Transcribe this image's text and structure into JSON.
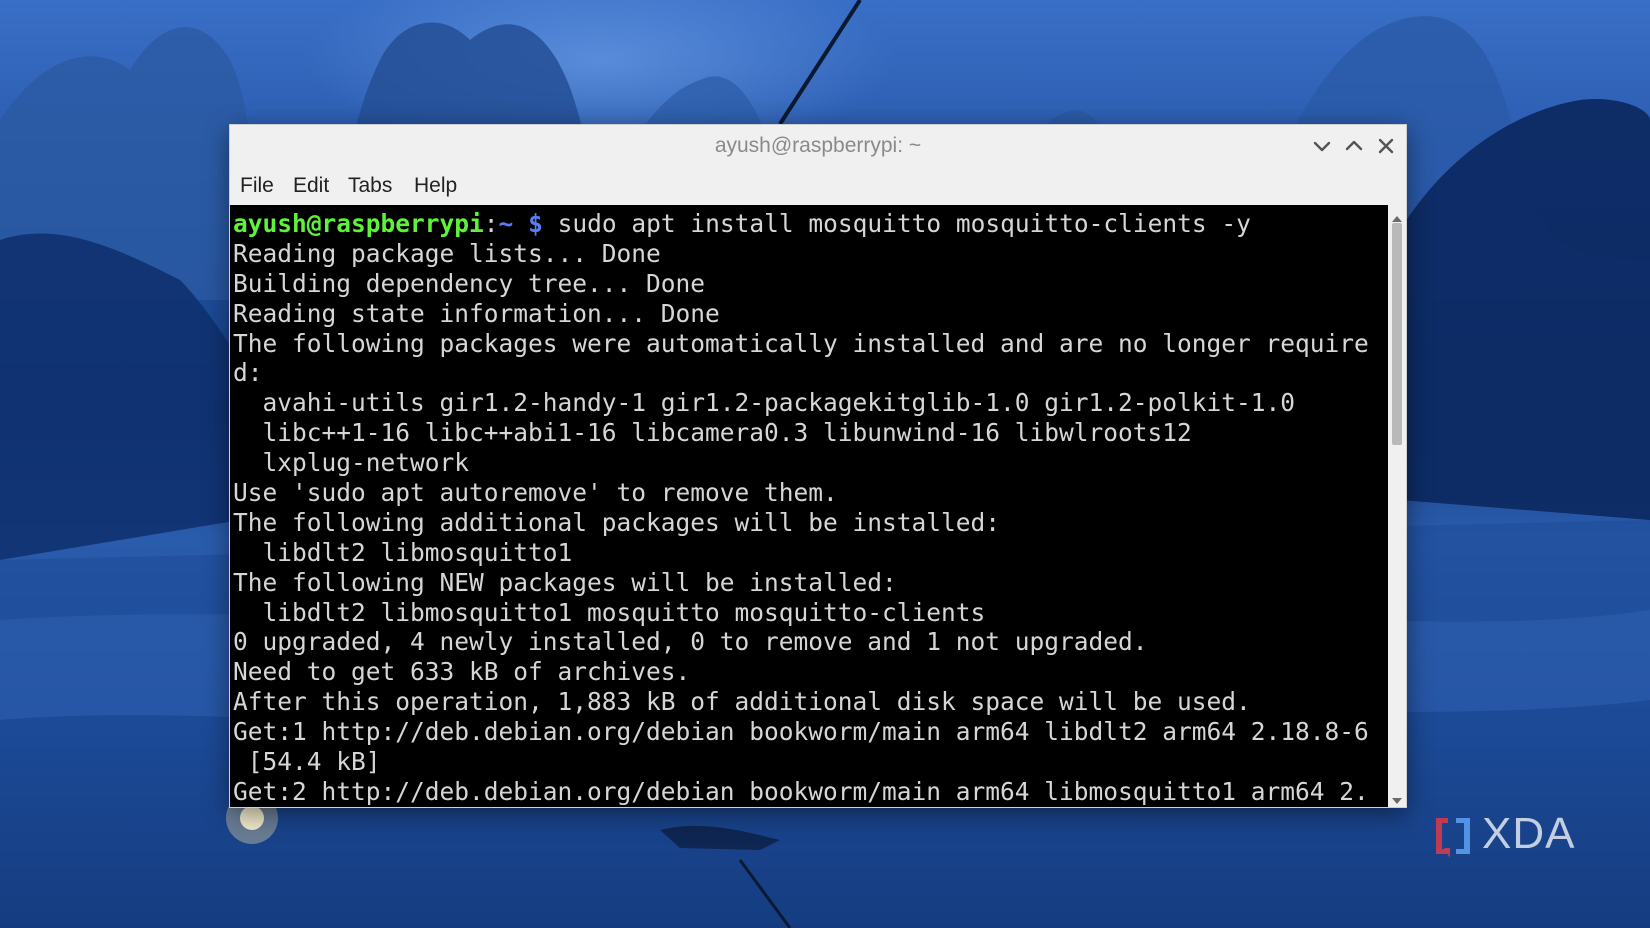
{
  "window": {
    "title": "ayush@raspberrypi: ~"
  },
  "menu": [
    {
      "label": "File"
    },
    {
      "label": "Edit"
    },
    {
      "label": "Tabs"
    },
    {
      "label": "Help"
    }
  ],
  "prompt": {
    "user_host": "ayush@raspberrypi",
    "separator": ":",
    "path": "~",
    "symbol": "$",
    "command": "sudo apt install mosquitto mosquitto-clients -y"
  },
  "output_lines": [
    "Reading package lists... Done",
    "Building dependency tree... Done",
    "Reading state information... Done",
    "The following packages were automatically installed and are no longer require",
    "d:",
    "  avahi-utils gir1.2-handy-1 gir1.2-packagekitglib-1.0 gir1.2-polkit-1.0",
    "  libc++1-16 libc++abi1-16 libcamera0.3 libunwind-16 libwlroots12",
    "  lxplug-network",
    "Use 'sudo apt autoremove' to remove them.",
    "The following additional packages will be installed:",
    "  libdlt2 libmosquitto1",
    "The following NEW packages will be installed:",
    "  libdlt2 libmosquitto1 mosquitto mosquitto-clients",
    "0 upgraded, 4 newly installed, 0 to remove and 1 not upgraded.",
    "Need to get 633 kB of archives.",
    "After this operation, 1,883 kB of additional disk space will be used.",
    "Get:1 http://deb.debian.org/debian bookworm/main arm64 libdlt2 arm64 2.18.8-6",
    " [54.4 kB]",
    "Get:2 http://deb.debian.org/debian bookworm/main arm64 libmosquitto1 arm64 2."
  ],
  "colors": {
    "prompt_user": "#5ef23a",
    "prompt_path": "#5b7cf5",
    "terminal_text": "#d6d6d6",
    "terminal_bg": "#000000",
    "chrome_bg": "#f0f0f0"
  },
  "icons": {
    "minimize": "chevron-down-icon",
    "maximize": "chevron-up-icon",
    "close": "close-icon",
    "scroll_up": "triangle-up-icon",
    "scroll_down": "triangle-down-icon"
  },
  "watermark": {
    "text": "XDA"
  }
}
